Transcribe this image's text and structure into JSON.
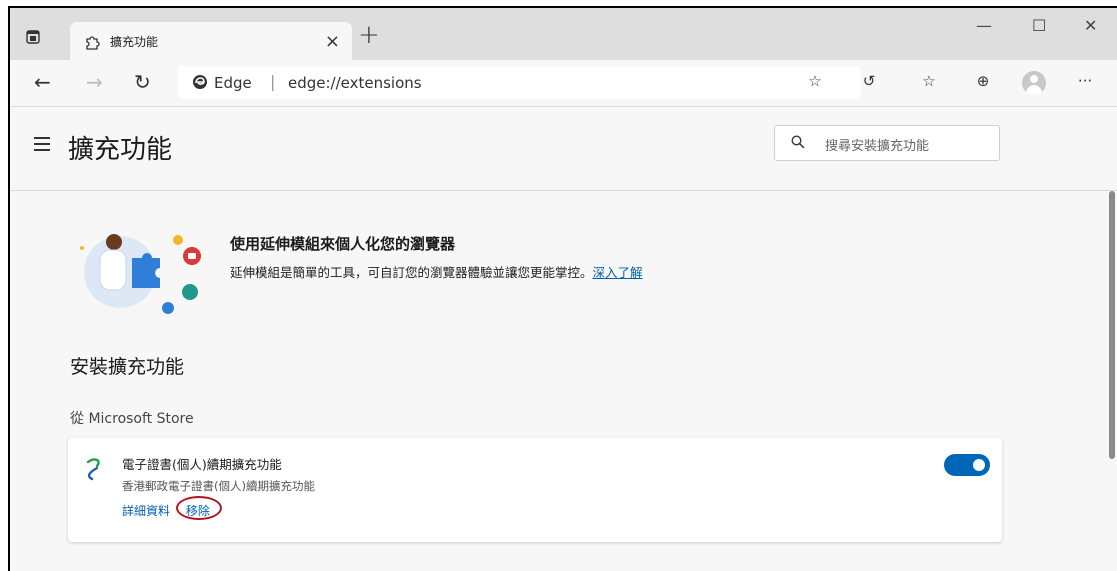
{
  "tab": {
    "title": "擴充功能",
    "close": "×",
    "new": "+"
  },
  "window": {
    "minimize": "—",
    "maximize": "☐",
    "close": "✕"
  },
  "address": {
    "site_name": "Edge",
    "separator": "|",
    "url": "edge://extensions"
  },
  "toolbar": {
    "more": "···"
  },
  "page": {
    "title": "擴充功能",
    "search_placeholder": "搜尋安裝擴充功能"
  },
  "promo": {
    "title": "使用延伸模組來個人化您的瀏覽器",
    "description": "延伸模組是簡單的工具，可自訂您的瀏覽器體驗並讓您更能掌控。",
    "link": "深入了解"
  },
  "installed": {
    "section_title": "安裝擴充功能",
    "source": "從 Microsoft Store",
    "extension": {
      "name": "電子證書(個人)續期擴充功能",
      "description": "香港郵政電子證書(個人)續期擴充功能",
      "details_link": "詳細資料",
      "remove_link": "移除",
      "enabled": true
    }
  },
  "colors": {
    "accent": "#0067b8",
    "link": "#0062ad",
    "highlight": "#b0151d"
  }
}
